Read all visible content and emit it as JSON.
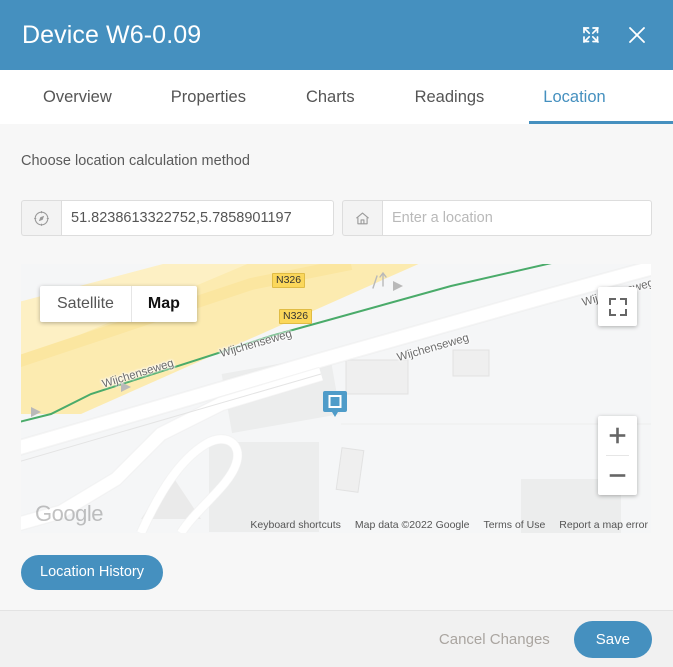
{
  "window": {
    "title": "Device W6-0.09",
    "expand_icon": "expand-arrows-icon",
    "close_icon": "close-icon"
  },
  "tabs": [
    {
      "label": "Overview",
      "active": false
    },
    {
      "label": "Properties",
      "active": false
    },
    {
      "label": "Charts",
      "active": false
    },
    {
      "label": "Readings",
      "active": false
    },
    {
      "label": "Location",
      "active": true
    }
  ],
  "main": {
    "section_label": "Choose location calculation method",
    "coordinates_field": {
      "icon": "compass-icon",
      "value": "51.8238613322752,5.7858901197",
      "placeholder": ""
    },
    "address_field": {
      "icon": "home-icon",
      "value": "",
      "placeholder": "Enter a location"
    },
    "location_history_label": "Location History"
  },
  "map": {
    "type_switch": [
      {
        "label": "Satellite",
        "selected": false
      },
      {
        "label": "Map",
        "selected": true
      }
    ],
    "fullscreen_icon": "fullscreen-icon",
    "zoom_in_label": "+",
    "zoom_out_label": "−",
    "watermark": "Google",
    "marker_icon": "device-marker-icon",
    "road_labels": [
      "Wijchenseweg",
      "Wijchenseweg",
      "Wijchenseweg",
      "Wijchenseweg"
    ],
    "shields": [
      "N326",
      "N326"
    ],
    "attribution": [
      "Keyboard shortcuts",
      "Map data ©2022 Google",
      "Terms of Use",
      "Report a map error"
    ]
  },
  "footer": {
    "cancel_label": "Cancel Changes",
    "save_label": "Save"
  },
  "colors": {
    "accent": "#4590bf",
    "page_bg": "#f7f7f7",
    "footer_bg": "#f1f1f1",
    "muted_text": "#aaa5a0",
    "road_shield": "#fbd75b"
  }
}
